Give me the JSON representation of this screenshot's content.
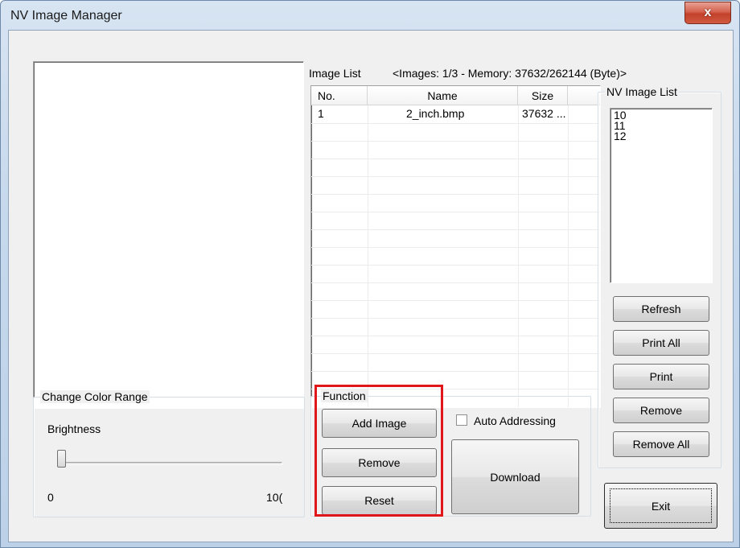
{
  "window": {
    "title": "NV Image Manager",
    "close_glyph": "x"
  },
  "image_list": {
    "label": "Image List",
    "status": "<Images: 1/3 - Memory: 37632/262144 (Byte)>",
    "columns": [
      "No.",
      "Name",
      "Size"
    ],
    "rows": [
      {
        "no": "1",
        "name": "2_inch.bmp",
        "size": "37632 ..."
      }
    ]
  },
  "nv_image_list": {
    "label": "NV Image List",
    "items": [
      "10",
      "11",
      "12"
    ],
    "buttons": {
      "refresh": "Refresh",
      "print_all": "Print All",
      "print": "Print",
      "remove": "Remove",
      "remove_all": "Remove All"
    }
  },
  "color_range": {
    "label": "Change Color Range",
    "brightness_label": "Brightness",
    "min_label": "0",
    "max_label": "10(",
    "brightness_value": 0
  },
  "function": {
    "label": "Function",
    "add_image": "Add Image",
    "remove": "Remove",
    "reset": "Reset",
    "auto_addressing_label": "Auto Addressing",
    "auto_addressing_checked": false,
    "download": "Download"
  },
  "exit_label": "Exit",
  "colors": {
    "highlight": "#e0161a",
    "close_button": "#c2412b",
    "dialog_bg": "#f0f0f0"
  }
}
